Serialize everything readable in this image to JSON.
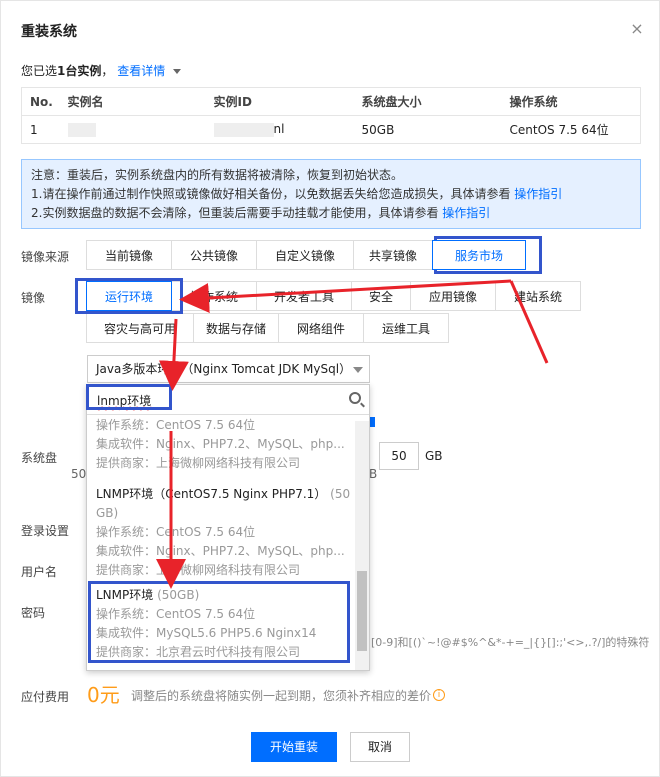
{
  "dialog": {
    "title": "重装系统",
    "close_glyph": "×"
  },
  "selected": {
    "prefix": "您已选",
    "count": "1台实例",
    "suffix": "，",
    "detail_link": "查看详情"
  },
  "table": {
    "headers": [
      "No.",
      "实例名",
      "实例ID",
      "系统盘大小",
      "操作系统"
    ],
    "rows": [
      {
        "no": "1",
        "name": "",
        "id": "nl",
        "disk": "50GB",
        "os": "CentOS 7.5 64位"
      }
    ]
  },
  "notice": {
    "line1": "注意：重装后，实例系统盘内的所有数据将被清除，恢复到初始状态。",
    "line2": "1.请在操作前通过制作快照或镜像做好相关备份，以免数据丢失给您造成损失，具体请参看",
    "line3": "2.实例数据盘的数据不会清除，但重装后需要手动挂载才能使用，具体请参看",
    "guide_link": "操作指引"
  },
  "image_source": {
    "label": "镜像来源",
    "tabs": [
      "当前镜像",
      "公共镜像",
      "自定义镜像",
      "共享镜像",
      "服务市场"
    ]
  },
  "image": {
    "label": "镜像",
    "row1": [
      "运行环境",
      "操作系统",
      "开发者工具",
      "安全",
      "应用镜像",
      "建站系统"
    ],
    "row2": [
      "容灾与高可用",
      "数据与存储",
      "网络组件",
      "运维工具"
    ],
    "selected_value": "Java多版本环境（Nginx Tomcat JDK MySql）"
  },
  "search": {
    "value": "lnmp环境"
  },
  "dropdown": {
    "partial": {
      "os": "操作系统：CentOS 7.5 64位",
      "software": "集成软件：Nginx、PHP7.2、MySQL、php...",
      "vendor": "提供商家：上海微柳网络科技有限公司"
    },
    "item2": {
      "name1": "LNMP环境（CentOS7.5 Nginx PHP7.1）",
      "size1": "(50",
      "size2": "GB)",
      "os": "操作系统：CentOS 7.5 64位",
      "software": "集成软件：Nginx、PHP7.2、MySQL、php...",
      "vendor": "提供商家：上海微柳网络科技有限公司"
    },
    "item3": {
      "name": "LNMP环境",
      "size": "(50GB)",
      "os": "操作系统：CentOS 7.5 64位",
      "software": "集成软件：MySQL5.6 PHP5.6 Nginx14",
      "vendor": "提供商家：北京君云时代科技有限公司"
    }
  },
  "form": {
    "disk_label": "系统盘",
    "disk_value": "50",
    "disk_unit": "GB",
    "disk_min": "50",
    "disk_unit_under": "B",
    "login_label": "登录设置",
    "user_label": "用户名",
    "password_label": "密码",
    "password_hint": "[0-9]和[()`~!@#$%^&*-+=_|{}[]:;'<>,.?/]的特殊符"
  },
  "cost": {
    "label": "应付费用",
    "price": "0元",
    "note": "调整后的系统盘将随实例一起到期，您须补齐相应的差价",
    "info_glyph": "i"
  },
  "buttons": {
    "start": "开始重装",
    "cancel": "取消"
  },
  "colors": {
    "accent": "#006eff",
    "annotation_box": "#3355cc",
    "annotation_arrow": "#e8232a",
    "price": "#ff9c19"
  }
}
